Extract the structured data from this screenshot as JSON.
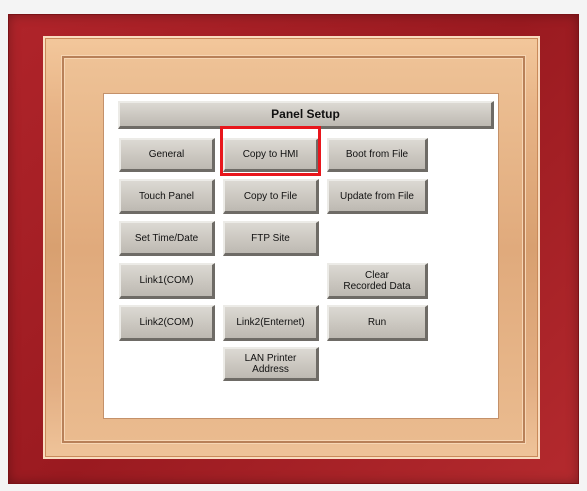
{
  "panel": {
    "title": "Panel Setup",
    "buttons": {
      "general": "General",
      "copy_to_hmi": "Copy to HMI",
      "boot_from_file": "Boot from File",
      "touch_panel": "Touch Panel",
      "copy_to_file": "Copy to File",
      "update_from_file": "Update from File",
      "set_time_date": "Set Time/Date",
      "ftp_site": "FTP Site",
      "link1_com": "Link1(COM)",
      "clear_recorded_data": "Clear\nRecorded Data",
      "link2_com": "Link2(COM)",
      "link2_enternet": "Link2(Enternet)",
      "run": "Run",
      "lan_printer_address": "LAN Printer\nAddress"
    }
  },
  "colors": {
    "frame": "#a51e24",
    "bevel": "#e2ad82",
    "highlight": "#e8161c",
    "button": "#cbc7c0"
  }
}
